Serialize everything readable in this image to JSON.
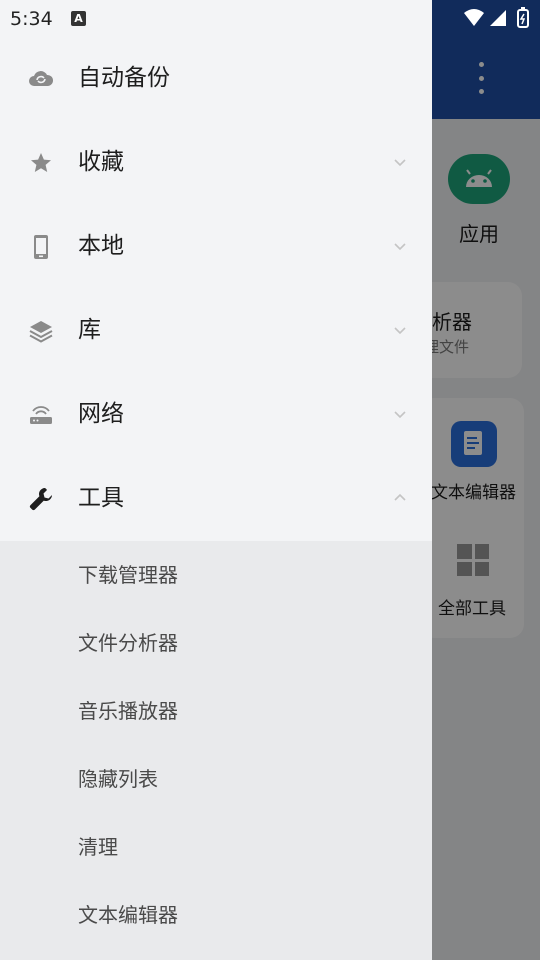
{
  "status_bar": {
    "time": "5:34",
    "notification_badge": "A"
  },
  "background_app": {
    "tiles": {
      "apps_label": "应用",
      "analyzer_title": "析器",
      "analyzer_subtitle": "理文件",
      "text_editor_label": "文本编辑器",
      "all_tools_label": "全部工具"
    }
  },
  "drawer": {
    "items": [
      {
        "label": "自动备份",
        "icon": "cloud-sync-icon",
        "chevron": "none"
      },
      {
        "label": "收藏",
        "icon": "star-icon",
        "chevron": "down"
      },
      {
        "label": "本地",
        "icon": "phone-icon",
        "chevron": "down"
      },
      {
        "label": "库",
        "icon": "layers-icon",
        "chevron": "down"
      },
      {
        "label": "网络",
        "icon": "router-icon",
        "chevron": "down"
      },
      {
        "label": "工具",
        "icon": "wrench-icon",
        "chevron": "up"
      }
    ],
    "tools_subitems": [
      {
        "label": "下载管理器"
      },
      {
        "label": "文件分析器"
      },
      {
        "label": "音乐播放器"
      },
      {
        "label": "隐藏列表"
      },
      {
        "label": "清理"
      },
      {
        "label": "文本编辑器"
      }
    ]
  },
  "colors": {
    "appbar": "#1f4fa6",
    "drawer_top": "#f3f4f6",
    "drawer_expanded": "#e9eaec",
    "icon_gray": "#8a8a8a",
    "android_green": "#1ea57a",
    "editor_blue": "#2b6fdc"
  }
}
